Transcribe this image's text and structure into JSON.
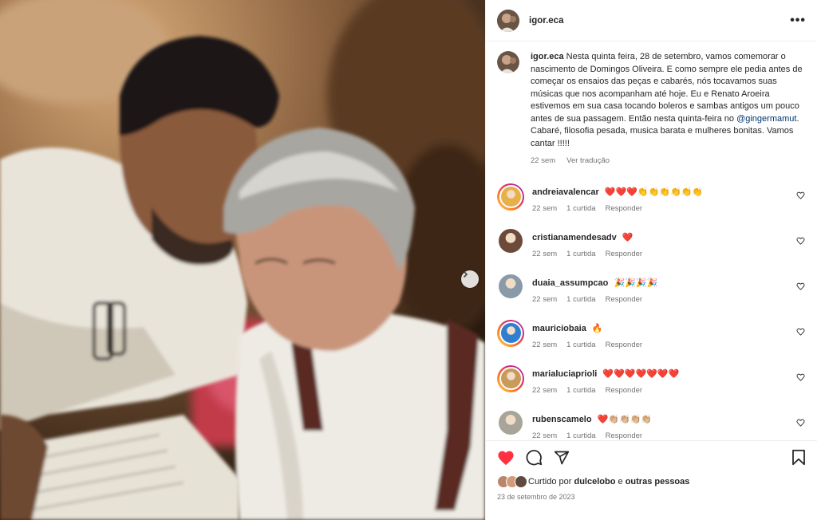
{
  "post": {
    "username": "igor.eca",
    "more_label": "•••",
    "caption": {
      "username": "igor.eca",
      "text_before": "Nesta quinta feira, 28 de setembro, vamos comemorar o nascimento de Domingos Oliveira. E como sempre ele pedia antes de começar os ensaios das peças e cabarés, nós tocavamos suas músicas que nos acompanham até hoje. Eu e Renato Aroeira estivemos em sua casa tocando boleros e sambas antigos um pouco antes de sua passagem. Então nesta quinta-feira no",
      "mention": "@gingermamut",
      "text_after": ". Cabaré, filosofia pesada, musica barata e mulheres bonitas. Vamos cantar !!!!!",
      "time": "22 sem",
      "translate": "Ver tradução"
    },
    "comments": [
      {
        "username": "andreiavalencar",
        "text": "❤️❤️❤️👏👏👏👏👏👏",
        "time": "22 sem",
        "likes": "1 curtida",
        "reply": "Responder",
        "story": true,
        "avatar_color": "#e8b04a"
      },
      {
        "username": "cristianamendesadv",
        "text": "❤️",
        "time": "22 sem",
        "likes": "1 curtida",
        "reply": "Responder",
        "story": false,
        "avatar_color": "#6b4a3a"
      },
      {
        "username": "duaia_assumpcao",
        "text": "🎉🎉🎉🎉",
        "time": "22 sem",
        "likes": "1 curtida",
        "reply": "Responder",
        "story": false,
        "avatar_color": "#8a9aa8"
      },
      {
        "username": "mauriciobaia",
        "text": "🔥",
        "time": "22 sem",
        "likes": "1 curtida",
        "reply": "Responder",
        "story": true,
        "avatar_color": "#2f7fd0"
      },
      {
        "username": "marialuciaprioli",
        "text": "❤️❤️❤️❤️❤️❤️❤️",
        "time": "22 sem",
        "likes": "1 curtida",
        "reply": "Responder",
        "story": true,
        "avatar_color": "#c99a5a"
      },
      {
        "username": "rubenscamelo",
        "text": "❤️👏🏼👏🏼👏🏼👏🏼",
        "time": "22 sem",
        "likes": "1 curtida",
        "reply": "Responder",
        "story": false,
        "avatar_color": "#a8a49a"
      }
    ],
    "liked_by": {
      "prefix": "Curtido por",
      "user": "dulcelobo",
      "connector": "e",
      "others": "outras pessoas"
    },
    "date": "23 de setembro de 2023",
    "icons": {
      "like": "heart-filled-icon",
      "comment": "comment-bubble-icon",
      "share": "paper-plane-icon",
      "save": "bookmark-icon",
      "next": "chevron-right-icon",
      "comment_like": "heart-outline-icon",
      "more": "more-dots-icon"
    },
    "colors": {
      "liked_heart": "#ff3040",
      "mention": "#00376b",
      "secondary_text": "#737373"
    }
  }
}
